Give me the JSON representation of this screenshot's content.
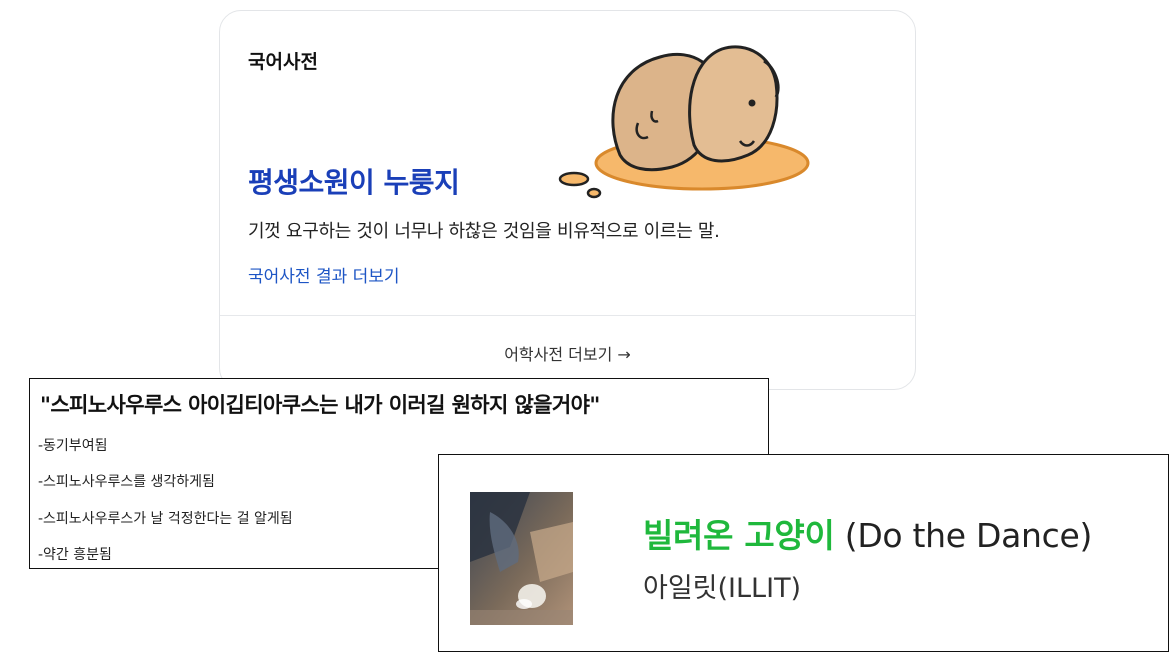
{
  "dictionary": {
    "label": "국어사전",
    "word": "평생소원이 누룽지",
    "definition": "기껏 요구하는 것이 너무나 하찮은 것임을 비유적으로 이르는 말.",
    "result_link": "국어사전 결과 더보기",
    "more_label": "어학사전 더보기 →",
    "illustration": "puppy-bun-illustration",
    "colors": {
      "word": "#1a3fb8",
      "link": "#1d55c5"
    }
  },
  "quote": {
    "title": "\"스피노사우루스 아이깁티아쿠스는 내가 이러길 원하지 않을거야\"",
    "lines": [
      "-동기부여됨",
      "-스피노사우루스를 생각하게됨",
      "-스피노사우루스가 날 걱정한다는 걸 알게됨",
      "-약간 흥분됨"
    ]
  },
  "song": {
    "title_ko": "빌려온 고양이",
    "title_en": " (Do the Dance)",
    "artist": "아일릿(ILLIT)",
    "album_art": "album-cover",
    "colors": {
      "title_ko": "#1fb83c"
    }
  }
}
